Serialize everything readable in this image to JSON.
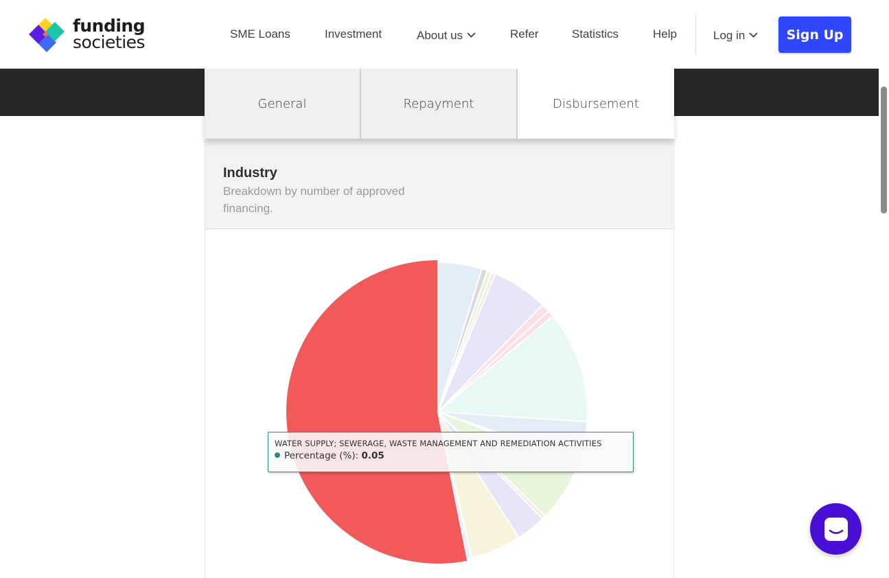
{
  "brand": {
    "line1": "funding",
    "line2": "societies"
  },
  "nav": {
    "items": [
      {
        "label": "SME Loans",
        "dropdown": false
      },
      {
        "label": "Investment",
        "dropdown": false
      },
      {
        "label": "About us",
        "dropdown": true
      },
      {
        "label": "Refer",
        "dropdown": false
      },
      {
        "label": "Statistics",
        "dropdown": false
      },
      {
        "label": "Help",
        "dropdown": false
      }
    ],
    "login": "Log in",
    "signup": "Sign Up"
  },
  "tabs": [
    {
      "label": "General",
      "active": false
    },
    {
      "label": "Repayment",
      "active": false
    },
    {
      "label": "Disbursement",
      "active": true
    }
  ],
  "card": {
    "title": "Industry",
    "subtitle": "Breakdown by number of approved financing."
  },
  "chart_data": {
    "type": "pie",
    "title": "Industry",
    "series_name": "Percentage (%)",
    "slices": [
      {
        "label": "",
        "value": 4.7,
        "color": "#e3edf8"
      },
      {
        "label": "",
        "value": 0.6,
        "color": "#d9d9d9"
      },
      {
        "label": "",
        "value": 0.5,
        "color": "#e6f5dc"
      },
      {
        "label": "",
        "value": 0.4,
        "color": "#fbe8dc"
      },
      {
        "label": "",
        "value": 6.0,
        "color": "#e6e6f8"
      },
      {
        "label": "",
        "value": 0.9,
        "color": "#fde0e6"
      },
      {
        "label": "",
        "value": 0.7,
        "color": "#fde0e6"
      },
      {
        "label": "",
        "value": 12.0,
        "color": "#e8f8f5"
      },
      {
        "label": "",
        "value": 4.2,
        "color": "#e3edf8"
      },
      {
        "label": "",
        "value": 0.5,
        "color": "#f1f1f1"
      },
      {
        "label": "",
        "value": 6.4,
        "color": "#e6f5dc"
      },
      {
        "label": "",
        "value": 0.4,
        "color": "#fbe8dc"
      },
      {
        "label": "",
        "value": 3.2,
        "color": "#e6e6f8"
      },
      {
        "label": "",
        "value": 5.4,
        "color": "#f8f3dc"
      },
      {
        "label": "",
        "value": 0.5,
        "color": "#f1f1f1"
      },
      {
        "label": "",
        "value": 52.6,
        "color": "#f25a5a"
      }
    ],
    "tooltip": {
      "label": "WATER SUPPLY; SEWERAGE, WASTE MANAGEMENT AND REMEDIATION ACTIVITIES",
      "series": "Percentage (%)",
      "value": "0.05",
      "color": "#2a8a8a"
    }
  }
}
